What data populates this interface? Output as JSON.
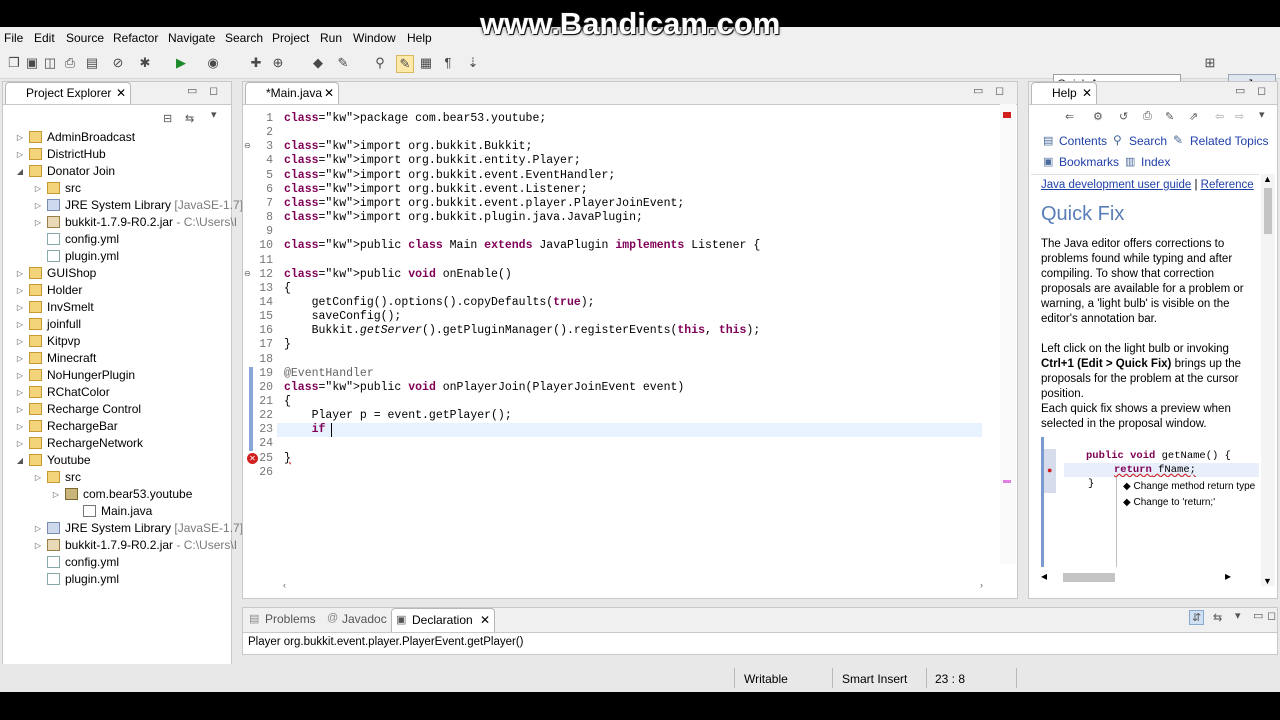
{
  "menu": [
    "File",
    "Edit",
    "Source",
    "Refactor",
    "Navigate",
    "Search",
    "Project",
    "Run",
    "Window",
    "Help"
  ],
  "watermark": "www.Bandicam.com",
  "quick_access_placeholder": "Quick Access",
  "perspective_label": "Java",
  "project_explorer": {
    "title": "Project Explorer",
    "items": [
      {
        "label": "AdminBroadcast",
        "type": "project"
      },
      {
        "label": "DistrictHub",
        "type": "project"
      },
      {
        "label": "Donator Join",
        "type": "project",
        "expanded": true
      },
      {
        "label": "src",
        "type": "src"
      },
      {
        "label": "JRE System Library",
        "suffix": " [JavaSE-1.7]",
        "type": "lib"
      },
      {
        "label": "bukkit-1.7.9-R0.2.jar",
        "suffix": " - C:\\Users\\I",
        "type": "jar"
      },
      {
        "label": "config.yml",
        "type": "file"
      },
      {
        "label": "plugin.yml",
        "type": "file"
      },
      {
        "label": "GUIShop",
        "type": "project"
      },
      {
        "label": "Holder",
        "type": "project"
      },
      {
        "label": "InvSmelt",
        "type": "project"
      },
      {
        "label": "joinfull",
        "type": "project"
      },
      {
        "label": "Kitpvp",
        "type": "project"
      },
      {
        "label": "Minecraft",
        "type": "project"
      },
      {
        "label": "NoHungerPlugin",
        "type": "project"
      },
      {
        "label": "RChatColor",
        "type": "project"
      },
      {
        "label": "Recharge Control",
        "type": "project"
      },
      {
        "label": "RechargeBar",
        "type": "project"
      },
      {
        "label": "RechargeNetwork",
        "type": "project"
      },
      {
        "label": "Youtube",
        "type": "project",
        "expanded": true
      },
      {
        "label": "src",
        "type": "src"
      },
      {
        "label": "com.bear53.youtube",
        "type": "package"
      },
      {
        "label": "Main.java",
        "type": "java"
      },
      {
        "label": "JRE System Library",
        "suffix": " [JavaSE-1.7]",
        "type": "lib"
      },
      {
        "label": "bukkit-1.7.9-R0.2.jar",
        "suffix": " - C:\\Users\\I",
        "type": "jar"
      },
      {
        "label": "config.yml",
        "type": "file"
      },
      {
        "label": "plugin.yml",
        "type": "file"
      }
    ]
  },
  "editor": {
    "tab_label": "*Main.java",
    "cursor_line": 23,
    "lines": [
      {
        "n": "1",
        "text": "package com.bear53.youtube;"
      },
      {
        "n": "2",
        "text": ""
      },
      {
        "n": "3",
        "text": "import org.bukkit.Bukkit;"
      },
      {
        "n": "4",
        "text": "import org.bukkit.entity.Player;"
      },
      {
        "n": "5",
        "text": "import org.bukkit.event.EventHandler;"
      },
      {
        "n": "6",
        "text": "import org.bukkit.event.Listener;"
      },
      {
        "n": "7",
        "text": "import org.bukkit.event.player.PlayerJoinEvent;"
      },
      {
        "n": "8",
        "text": "import org.bukkit.plugin.java.JavaPlugin;"
      },
      {
        "n": "9",
        "text": ""
      },
      {
        "n": "10",
        "text": "public class Main extends JavaPlugin implements Listener {"
      },
      {
        "n": "11",
        "text": ""
      },
      {
        "n": "12",
        "text": "public void onEnable()"
      },
      {
        "n": "13",
        "text": "{"
      },
      {
        "n": "14",
        "text": "    getConfig().options().copyDefaults(true);"
      },
      {
        "n": "15",
        "text": "    saveConfig();"
      },
      {
        "n": "16",
        "text": "    Bukkit.getServer().getPluginManager().registerEvents(this, this);"
      },
      {
        "n": "17",
        "text": "}"
      },
      {
        "n": "18",
        "text": ""
      },
      {
        "n": "19",
        "text": "@EventHandler"
      },
      {
        "n": "20",
        "text": "public void onPlayerJoin(PlayerJoinEvent event)"
      },
      {
        "n": "21",
        "text": "{"
      },
      {
        "n": "22",
        "text": "    Player p = event.getPlayer();"
      },
      {
        "n": "23",
        "text": "    if "
      },
      {
        "n": "24",
        "text": ""
      },
      {
        "n": "25",
        "text": "}"
      },
      {
        "n": "26",
        "text": ""
      }
    ]
  },
  "help": {
    "title": "Help",
    "nav": {
      "contents": "Contents",
      "search": "Search",
      "related": "Related Topics",
      "bookmarks": "Bookmarks",
      "index": "Index"
    },
    "breadcrumb": [
      "Java development user guide",
      "Reference"
    ],
    "heading": "Quick Fix",
    "p1": "The Java editor offers corrections to problems found while typing and after compiling. To show that correction proposals are available for a problem or warning, a 'light bulb' is visible on the editor's annotation bar.",
    "p2a": "Left click on the light bulb or invoking ",
    "p2b": "Ctrl+1 (Edit > Quick Fix)",
    "p2c": " brings up the proposals for the problem at the cursor position.",
    "p3": "Each quick fix shows a preview when selected in the proposal window.",
    "sample": {
      "line1": "public void getName() {",
      "line2": "return fName;",
      "line3": "}",
      "prop1": "Change method return type",
      "prop2": "Change to 'return;'"
    }
  },
  "bottom": {
    "tabs": [
      "Problems",
      "Javadoc",
      "Declaration"
    ],
    "active": "Declaration",
    "content": "Player org.bukkit.event.player.PlayerEvent.getPlayer()"
  },
  "status": {
    "writable": "Writable",
    "insert_mode": "Smart Insert",
    "position": "23 : 8"
  }
}
